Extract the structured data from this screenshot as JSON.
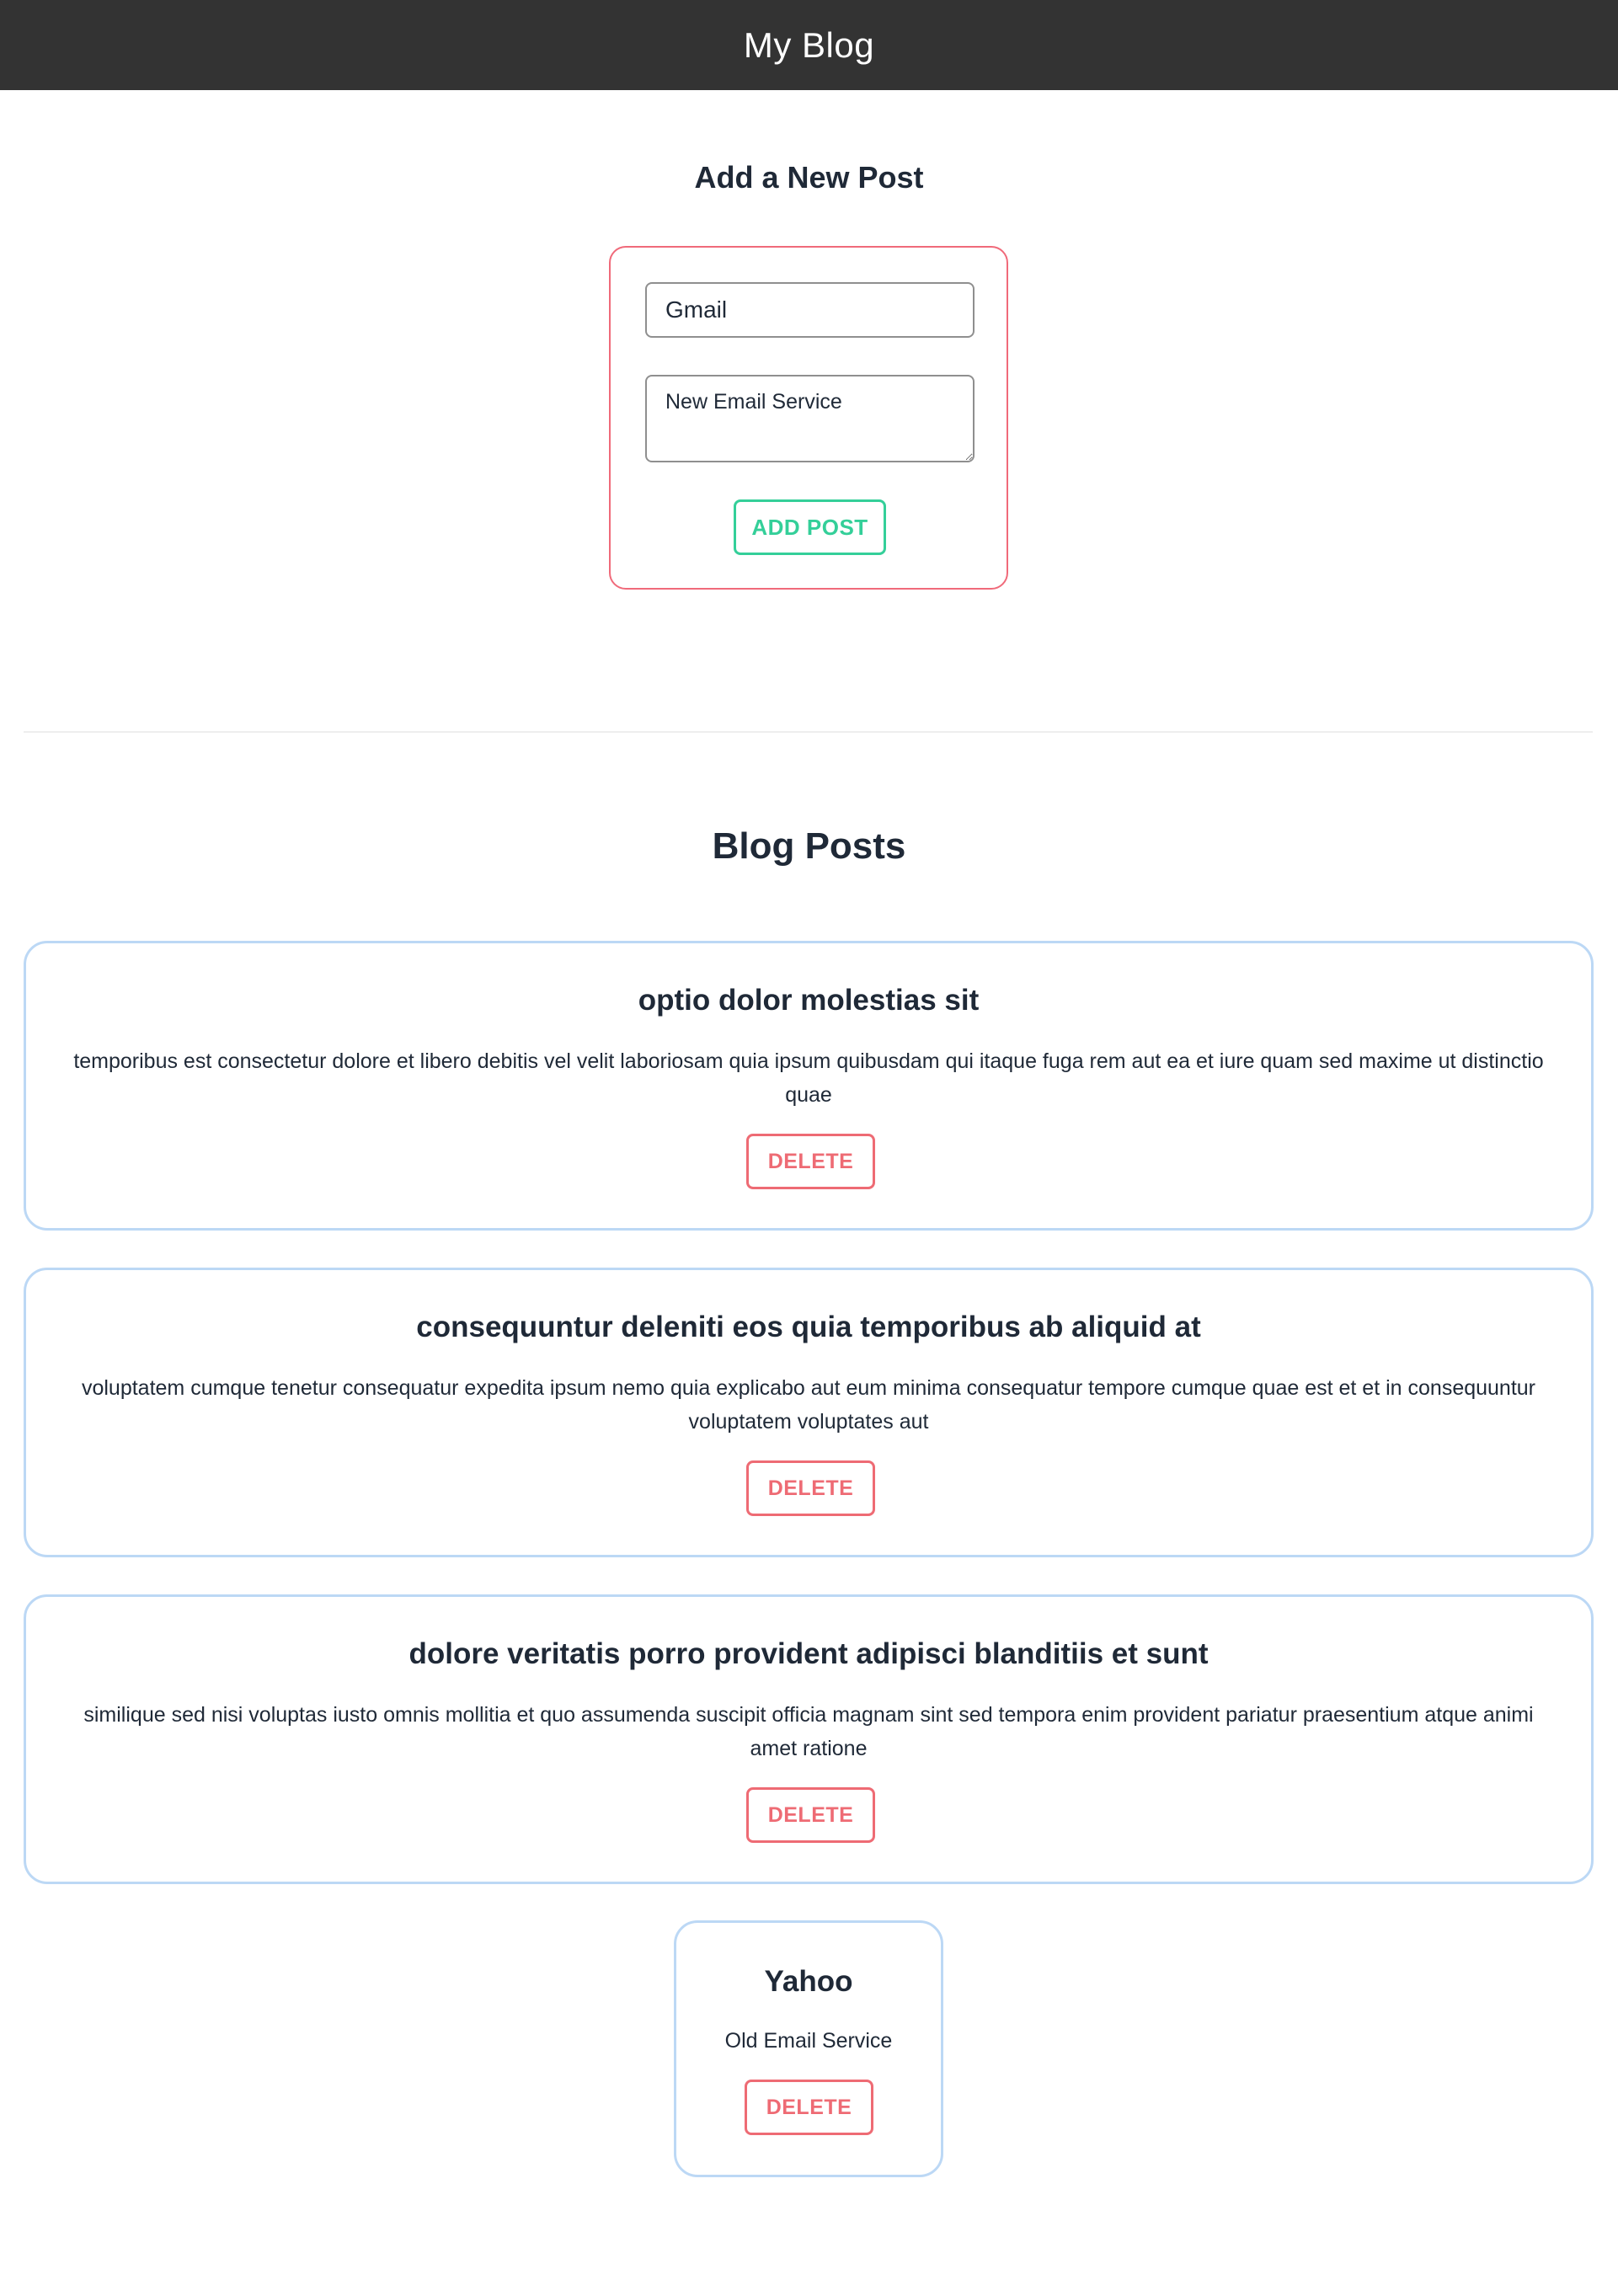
{
  "header": {
    "title": "My Blog"
  },
  "add_post": {
    "heading": "Add a New Post",
    "title_value": "Gmail",
    "body_value": "New Email Service",
    "button_label": "ADD POST"
  },
  "posts_section": {
    "heading": "Blog Posts",
    "delete_label": "DELETE",
    "posts": [
      {
        "title": "optio dolor molestias sit",
        "body": "temporibus est consectetur dolore et libero debitis vel velit laboriosam quia ipsum quibusdam qui itaque fuga rem aut ea et iure quam sed maxime ut distinctio quae"
      },
      {
        "title": "consequuntur deleniti eos quia temporibus ab aliquid at",
        "body": "voluptatem cumque tenetur consequatur expedita ipsum nemo quia explicabo aut eum minima consequatur tempore cumque quae est et et in consequuntur voluptatem voluptates aut"
      },
      {
        "title": "dolore veritatis porro provident adipisci blanditiis et sunt",
        "body": "similique sed nisi voluptas iusto omnis mollitia et quo assumenda suscipit officia magnam sint sed tempora enim provident pariatur praesentium atque animi amet ratione"
      },
      {
        "title": "Yahoo",
        "body": "Old Email Service"
      }
    ]
  },
  "colors": {
    "header_bg": "#333333",
    "form_border": "#f06a7a",
    "add_button": "#34cf99",
    "card_border": "#bcd8f5",
    "delete_button": "#ee6b74"
  }
}
